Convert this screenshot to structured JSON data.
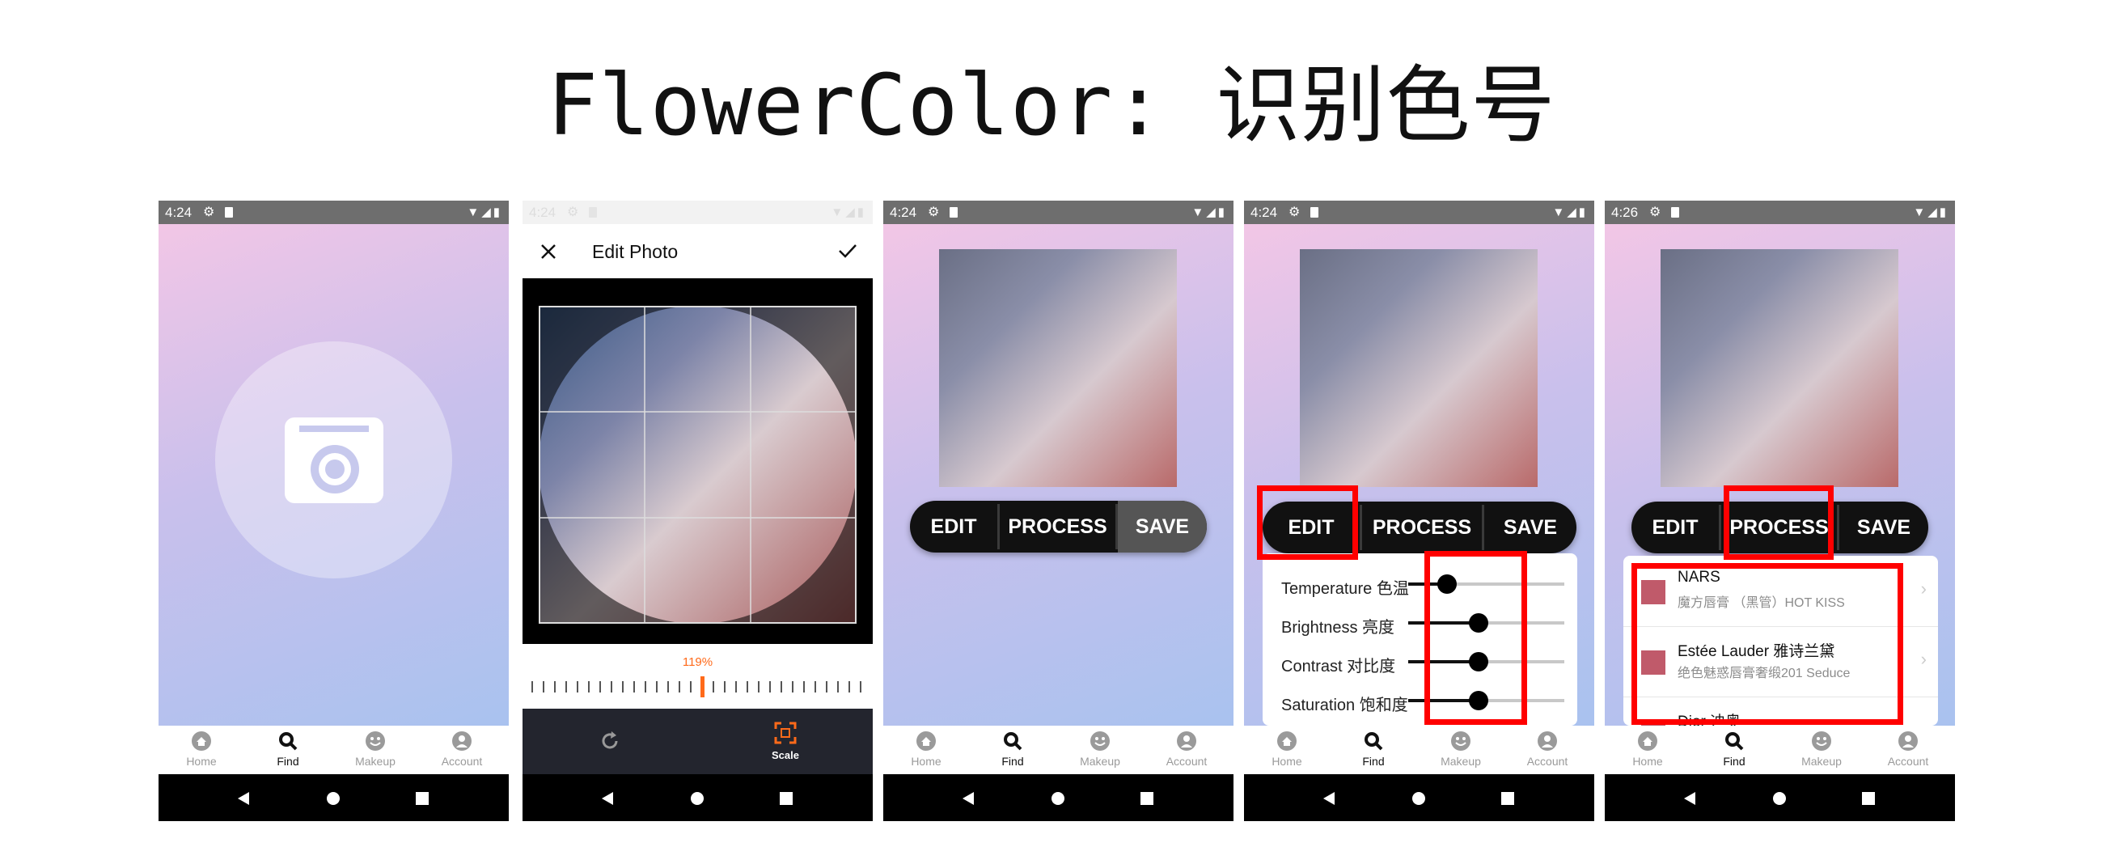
{
  "page": {
    "title": "FlowerColor: 识别色号"
  },
  "status": {
    "time_a": "4:24",
    "time_b": "4:26"
  },
  "nav": {
    "home": "Home",
    "find": "Find",
    "makeup": "Makeup",
    "account": "Account"
  },
  "edit_photo": {
    "title": "Edit Photo",
    "zoom": "119%",
    "scale_label": "Scale"
  },
  "buttons": {
    "edit": "EDIT",
    "process": "PROCESS",
    "save": "SAVE"
  },
  "sliders": [
    {
      "label": "Temperature 色温",
      "value": 0.25
    },
    {
      "label": "Brightness 亮度",
      "value": 0.45
    },
    {
      "label": "Contrast 对比度",
      "value": 0.45
    },
    {
      "label": "Saturation 饱和度",
      "value": 0.45
    }
  ],
  "results": [
    {
      "brand": "NARS",
      "shade": "魔方唇膏 （黑管）HOT KISS",
      "color": "#c05a6a"
    },
    {
      "brand": "Estée Lauder 雅诗兰黛",
      "shade": "绝色魅惑唇膏奢缎201 Seduce",
      "color": "#c05a6a"
    },
    {
      "brand": "Dior 迪奥",
      "shade": "",
      "color": "#c05a6a"
    }
  ],
  "colors": {
    "highlight": "#ff0000",
    "accent": "#ff6a1a",
    "button_dark": "#111111",
    "save_gray": "#555555"
  },
  "icons": {
    "nav": [
      "home-icon",
      "search-icon",
      "smile-icon",
      "account-icon"
    ],
    "system": [
      "back-icon",
      "home-circle-icon",
      "recents-icon"
    ]
  }
}
